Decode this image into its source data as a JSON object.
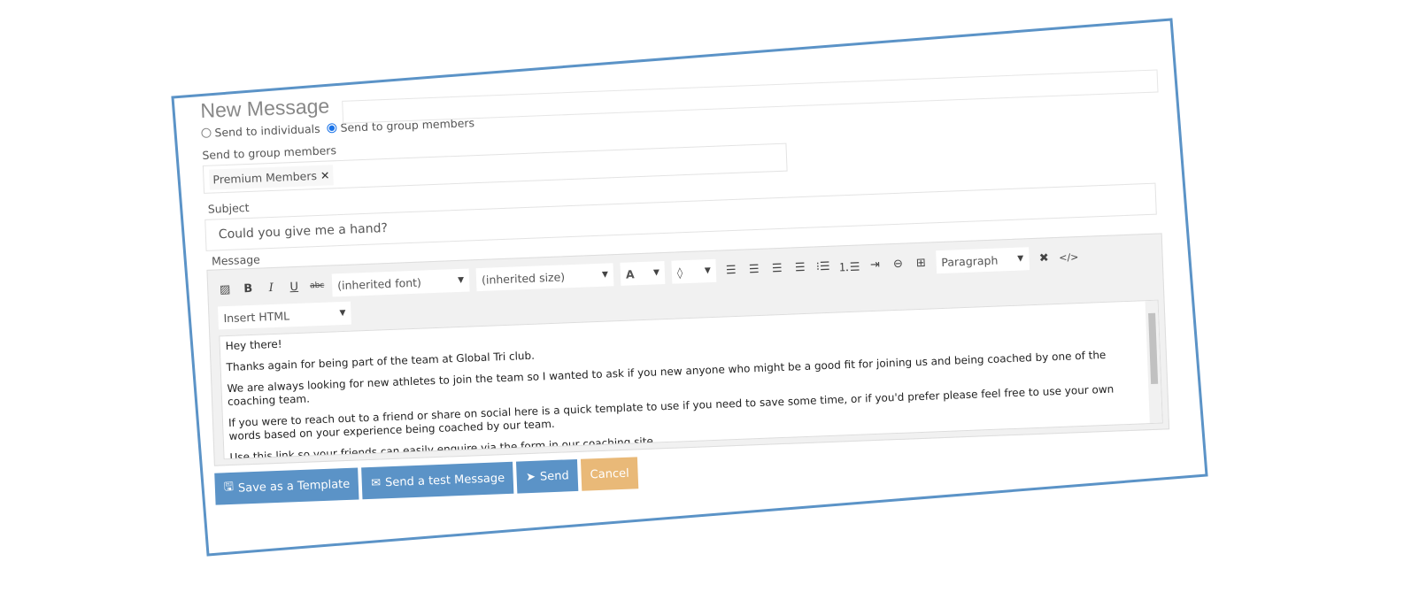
{
  "title": "New Message",
  "recipients": {
    "options": [
      "Send to individuals",
      "Send to group members"
    ],
    "selected": "Send to group members"
  },
  "group_label": "Send to group members",
  "group_tags": [
    "Premium Members"
  ],
  "subject": {
    "label": "Subject",
    "value": "Could you give me a hand?"
  },
  "message": {
    "label": "Message",
    "toolbar": {
      "font": "(inherited font)",
      "size": "(inherited size)",
      "font_color": "A",
      "block": "Paragraph",
      "insert": "Insert HTML",
      "icons": [
        "image-icon",
        "bold-icon",
        "italic-icon",
        "underline-icon",
        "strikethrough-icon",
        "font-color-icon",
        "highlight-icon",
        "align-left-icon",
        "align-center-icon",
        "align-right-icon",
        "justify-icon",
        "bullet-list-icon",
        "numbered-list-icon",
        "indent-icon",
        "link-icon",
        "table-icon",
        "clear-format-icon",
        "code-icon"
      ]
    },
    "paragraphs": [
      "Hey there!",
      "Thanks again for being part of the team at Global Tri club.",
      "We are always looking for new athletes to join the team so I wanted to ask if you new anyone who might be a good fit for joining us and being coached by one of the coaching team.",
      "If you were to reach out to a friend or share on social here is a quick template to use if you need to save some time, or if you'd prefer please feel free to use your own words based on your experience being coached by our team.",
      "Use this link so your friends can easily enquire via the form in our coaching site."
    ]
  },
  "buttons": {
    "save_template": "Save as a Template",
    "send_test": "Send a test Message",
    "send": "Send",
    "cancel": "Cancel"
  },
  "colors": {
    "frame": "#5b93c7",
    "primary": "#5b93c7",
    "cancel": "#e9b978"
  }
}
